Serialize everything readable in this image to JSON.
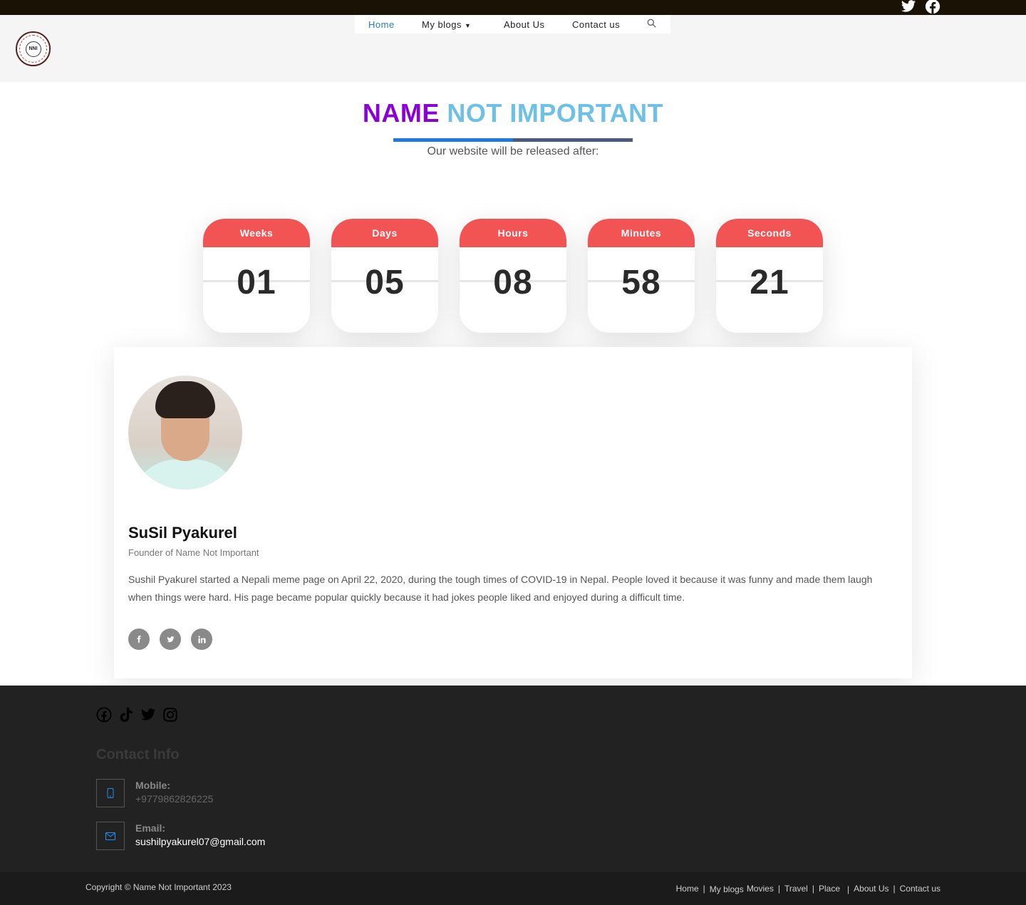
{
  "header": {
    "logo_text": "NNI",
    "nav": {
      "home": "Home",
      "my_blogs": "My blogs",
      "about": "About Us",
      "contact": "Contact us"
    },
    "top_social_icons": [
      "twitter-icon",
      "facebook-icon"
    ]
  },
  "hero": {
    "title_part1": "NAME",
    "title_part2": "NOT IMPORTANT",
    "subtitle": "Our website will be released after:",
    "progress_fraction": 0.5
  },
  "countdown": [
    {
      "label": "Weeks",
      "value": "01"
    },
    {
      "label": "Days",
      "value": "05"
    },
    {
      "label": "Hours",
      "value": "08"
    },
    {
      "label": "Minutes",
      "value": "58"
    },
    {
      "label": "Seconds",
      "value": "21"
    }
  ],
  "profile": {
    "name": "SuSil Pyakurel",
    "role": "Founder of Name Not Important",
    "bio": "Sushil Pyakurel started a Nepali meme page on April 22, 2020, during the tough times of COVID-19 in Nepal. People loved it because it was funny and made them laugh when things were hard. His page became popular quickly because it had jokes people liked and enjoyed during a difficult time.",
    "social_icons": [
      "facebook-icon",
      "twitter-icon",
      "linkedin-icon"
    ]
  },
  "footer": {
    "social_icons": [
      "facebook-icon",
      "tiktok-icon",
      "twitter-icon",
      "instagram-icon"
    ],
    "contact_title": "Contact Info",
    "mobile_label": "Mobile:",
    "mobile_value": "+9779862826225",
    "email_label": "Email:",
    "email_value": "sushilpyakurel07@gmail.com",
    "copyright": "Copyright © Name Not Important 2023",
    "menu": {
      "home": "Home",
      "my_blogs": "My blogs",
      "movies": "Movies",
      "travel": "Travel",
      "place": "Place",
      "about": "About Us",
      "contact": "Contact us"
    }
  },
  "colors": {
    "topbar": "#1a1305",
    "title_purple": "#8b00d6",
    "title_blue": "#6ec1e4",
    "countdown_red": "#f25454",
    "footer_bg": "#222222",
    "nav_active": "#2a7bb5"
  }
}
